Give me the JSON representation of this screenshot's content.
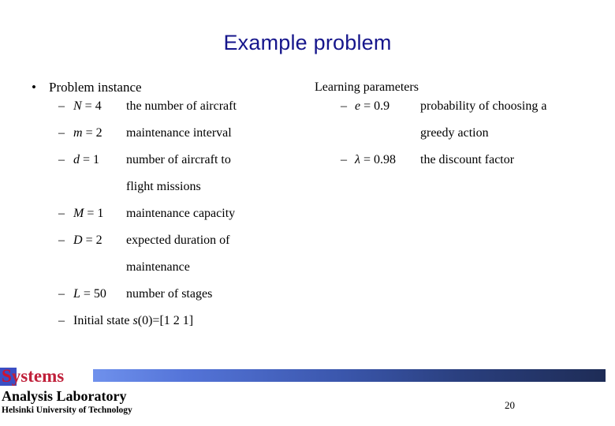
{
  "slide": {
    "title": "Example problem",
    "page_number": "20",
    "title_color": "#16168c"
  },
  "left_column": {
    "heading": "Problem instance",
    "bullet_glyph": "•",
    "dash_glyph": "–",
    "items": [
      {
        "symbol_var": "N",
        "symbol_rest": " = 4",
        "desc": "the number of aircraft"
      },
      {
        "symbol_var": "m",
        "symbol_rest": " = 2",
        "desc": "maintenance interval"
      },
      {
        "symbol_var": "d",
        "symbol_rest": " = 1",
        "desc": "number of aircraft to"
      },
      {
        "continuation": "flight missions"
      },
      {
        "symbol_var": "M",
        "symbol_rest": " = 1",
        "desc": "maintenance capacity"
      },
      {
        "symbol_var": "D",
        "symbol_rest": " = 2",
        "desc": "expected duration of"
      },
      {
        "continuation": "maintenance"
      },
      {
        "symbol_var": "L",
        "symbol_rest": " = 50",
        "desc": "number of stages"
      },
      {
        "run_prefix": "Initial state ",
        "run_var": "s",
        "run_suffix": "(0)=[1 2 1]"
      }
    ]
  },
  "right_column": {
    "heading": "Learning parameters",
    "dash_glyph": "–",
    "items": [
      {
        "symbol_var": "e",
        "symbol_rest": " = 0.9",
        "desc": "probability of choosing a"
      },
      {
        "continuation": "greedy action"
      },
      {
        "symbol_var": "λ",
        "symbol_rest": " = 0.98",
        "desc": "the discount factor"
      }
    ]
  },
  "footer": {
    "logo_s": "S",
    "logo_rest": "ystems",
    "logo_line2": "Analysis Laboratory",
    "logo_line3": "Helsinki University of Technology",
    "accent_red": "#c0203a",
    "accent_blue": "#3b4fc4"
  }
}
